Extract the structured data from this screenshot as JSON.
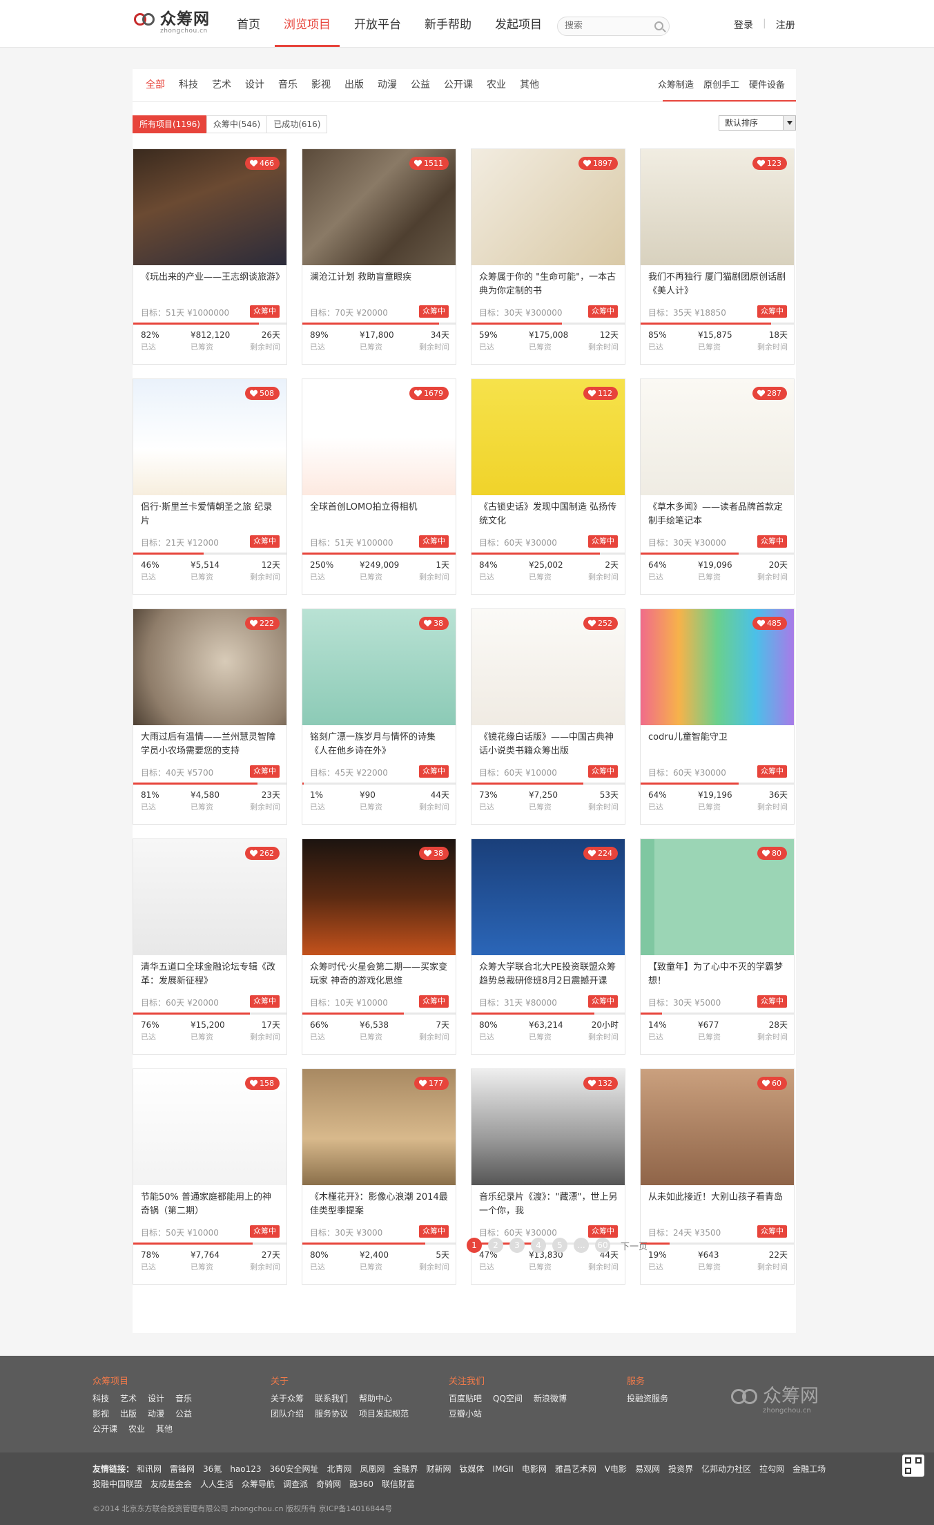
{
  "header": {
    "logo_name": "众筹网",
    "logo_sub": "zhongchou.cn",
    "nav": [
      "首页",
      "浏览项目",
      "开放平台",
      "新手帮助",
      "发起项目"
    ],
    "search_placeholder": "搜索",
    "login": "登录",
    "register": "注册"
  },
  "categories": {
    "left": [
      "全部",
      "科技",
      "艺术",
      "设计",
      "音乐",
      "影视",
      "出版",
      "动漫",
      "公益",
      "公开课",
      "农业",
      "其他"
    ],
    "right": [
      "众筹制造",
      "原创手工",
      "硬件设备"
    ]
  },
  "filters": [
    "所有项目(1196)",
    "众筹中(546)",
    "已成功(616)"
  ],
  "sort": "默认排序",
  "labels": {
    "reached": "已达",
    "raised": "已筹资",
    "remaining": "剩余时间"
  },
  "projects": [
    {
      "likes": "466",
      "title": "《玩出来的产业——王志纲谈旅游》",
      "goal": "目标：51天 ¥1000000",
      "status": "众筹中",
      "pct": "82%",
      "raised": "¥812,120",
      "left": "26天",
      "progress": 82
    },
    {
      "likes": "1511",
      "title": "澜沧江计划 救助盲童眼疾",
      "goal": "目标：70天 ¥20000",
      "status": "众筹中",
      "pct": "89%",
      "raised": "¥17,800",
      "left": "34天",
      "progress": 89
    },
    {
      "likes": "1897",
      "title": "众筹属于你的 \"生命可能\"，一本古典为你定制的书",
      "goal": "目标：30天 ¥300000",
      "status": "众筹中",
      "pct": "59%",
      "raised": "¥175,008",
      "left": "12天",
      "progress": 59
    },
    {
      "likes": "123",
      "title": "我们不再独行 厦门猫剧团原创话剧《美人计》",
      "goal": "目标：35天 ¥18850",
      "status": "众筹中",
      "pct": "85%",
      "raised": "¥15,875",
      "left": "18天",
      "progress": 85
    },
    {
      "likes": "508",
      "title": "侣行·斯里兰卡爱情朝圣之旅 纪录片",
      "goal": "目标：21天 ¥12000",
      "status": "众筹中",
      "pct": "46%",
      "raised": "¥5,514",
      "left": "12天",
      "progress": 46
    },
    {
      "likes": "1679",
      "title": "全球首创LOMO拍立得相机",
      "goal": "目标：51天 ¥100000",
      "status": "众筹中",
      "pct": "250%",
      "raised": "¥249,009",
      "left": "1天",
      "progress": 100
    },
    {
      "likes": "112",
      "title": "《古锁史话》发现中国制造 弘扬传统文化",
      "goal": "目标：60天 ¥30000",
      "status": "众筹中",
      "pct": "84%",
      "raised": "¥25,002",
      "left": "2天",
      "progress": 84
    },
    {
      "likes": "287",
      "title": "《草木多闻》——读者品牌首款定制手绘笔记本",
      "goal": "目标：30天 ¥30000",
      "status": "众筹中",
      "pct": "64%",
      "raised": "¥19,096",
      "left": "20天",
      "progress": 64
    },
    {
      "likes": "222",
      "title": "大雨过后有温情——兰州慧灵智障学员小农场需要您的支持",
      "goal": "目标：40天 ¥5700",
      "status": "众筹中",
      "pct": "81%",
      "raised": "¥4,580",
      "left": "23天",
      "progress": 81
    },
    {
      "likes": "38",
      "title": "铭刻广漂一族岁月与情怀的诗集《人在他乡诗在外》",
      "goal": "目标：45天 ¥22000",
      "status": "众筹中",
      "pct": "1%",
      "raised": "¥90",
      "left": "44天",
      "progress": 1
    },
    {
      "likes": "252",
      "title": "《镜花缘白话版》——中国古典神话小说类书籍众筹出版",
      "goal": "目标：60天 ¥10000",
      "status": "众筹中",
      "pct": "73%",
      "raised": "¥7,250",
      "left": "53天",
      "progress": 73
    },
    {
      "likes": "485",
      "title": "codru儿童智能守卫",
      "goal": "目标：60天 ¥30000",
      "status": "众筹中",
      "pct": "64%",
      "raised": "¥19,196",
      "left": "36天",
      "progress": 64
    },
    {
      "likes": "262",
      "title": "清华五道口全球金融论坛专辑《改革：发展新征程》",
      "goal": "目标：60天 ¥20000",
      "status": "众筹中",
      "pct": "76%",
      "raised": "¥15,200",
      "left": "17天",
      "progress": 76
    },
    {
      "likes": "38",
      "title": "众筹时代·火星会第二期——买家变玩家 神奇的游戏化思维",
      "goal": "目标：10天 ¥10000",
      "status": "众筹中",
      "pct": "66%",
      "raised": "¥6,538",
      "left": "7天",
      "progress": 66
    },
    {
      "likes": "224",
      "title": "众筹大学联合北大PE投资联盟众筹趋势总裁研修班8月2日震撼开课",
      "goal": "目标：31天 ¥80000",
      "status": "众筹中",
      "pct": "80%",
      "raised": "¥63,214",
      "left": "20小时",
      "progress": 80
    },
    {
      "likes": "80",
      "title": "【致童年】为了心中不灭的学霸梦想！",
      "goal": "目标：30天 ¥5000",
      "status": "众筹中",
      "pct": "14%",
      "raised": "¥677",
      "left": "28天",
      "progress": 14
    },
    {
      "likes": "158",
      "title": "节能50% 普通家庭都能用上的神奇锅（第二期）",
      "goal": "目标：50天 ¥10000",
      "status": "众筹中",
      "pct": "78%",
      "raised": "¥7,764",
      "left": "27天",
      "progress": 78
    },
    {
      "likes": "177",
      "title": "《木槿花开》：影像心浪潮 2014最佳类型季提案",
      "goal": "目标：30天 ¥3000",
      "status": "众筹中",
      "pct": "80%",
      "raised": "¥2,400",
      "left": "5天",
      "progress": 80
    },
    {
      "likes": "132",
      "title": "音乐纪录片《渡》：\"藏漂\"，世上另一个你，我",
      "goal": "目标：60天 ¥30000",
      "status": "众筹中",
      "pct": "47%",
      "raised": "¥13,830",
      "left": "44天",
      "progress": 47
    },
    {
      "likes": "60",
      "title": "从未如此接近！大别山孩子看青岛",
      "goal": "目标：24天 ¥3500",
      "status": "众筹中",
      "pct": "19%",
      "raised": "¥643",
      "left": "22天",
      "progress": 19
    }
  ],
  "pagination": {
    "pages": [
      "1",
      "2",
      "3",
      "4",
      "5",
      "...",
      "60"
    ],
    "next": "下一页"
  },
  "footer": {
    "cols": [
      {
        "title": "众筹项目",
        "rows": [
          [
            "科技",
            "艺术",
            "设计",
            "音乐"
          ],
          [
            "影视",
            "出版",
            "动漫",
            "公益"
          ],
          [
            "公开课",
            "农业",
            "其他"
          ]
        ]
      },
      {
        "title": "关于",
        "rows": [
          [
            "关于众筹",
            "联系我们",
            "帮助中心"
          ],
          [
            "团队介绍",
            "服务协议",
            "项目发起规范"
          ]
        ]
      },
      {
        "title": "关注我们",
        "rows": [
          [
            "百度贴吧",
            "QQ空间",
            "新浪微博"
          ],
          [
            "豆瓣小站"
          ]
        ]
      },
      {
        "title": "服务",
        "rows": [
          [
            "投融资服务"
          ]
        ]
      }
    ],
    "logo_name": "众筹网",
    "logo_sub": "zhongchou.cn",
    "links_label": "友情链接：",
    "links": [
      "和讯网",
      "雷锋网",
      "36氪",
      "hao123",
      "360安全网址",
      "北青网",
      "凤凰网",
      "金融界",
      "财新网",
      "钛媒体",
      "IMGII",
      "电影网",
      "雅昌艺术网",
      "V电影",
      "易观网",
      "投资界",
      "亿邦动力社区",
      "拉勾网",
      "金融工场",
      "投融中国联盟",
      "友成基金会",
      "人人生活",
      "众筹导航",
      "调查派",
      "奇骑网",
      "融360",
      "联信财富"
    ],
    "copyright": "©2014 北京东方联合投资管理有限公司 zhongchou.cn 版权所有 京ICP备14016844号"
  },
  "colors": {
    "accent": "#e7443b",
    "footer_bg": "#5b5b5b"
  }
}
